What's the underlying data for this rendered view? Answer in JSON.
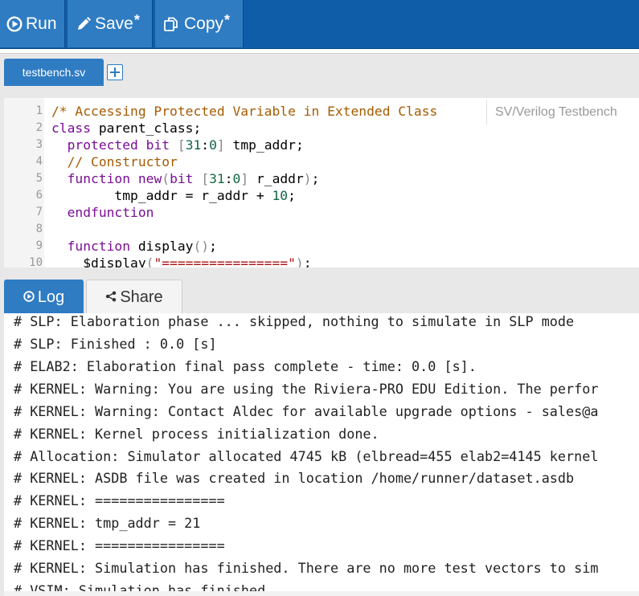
{
  "toolbar": {
    "run_label": "Run",
    "save_label": "Save",
    "copy_label": "Copy",
    "modified_marker": "*"
  },
  "editor": {
    "file_tab": "testbench.sv",
    "language_label": "SV/Verilog Testbench",
    "lines": [
      {
        "n": "1",
        "tokens": [
          {
            "t": "/* Accessing Protected Variable in Extended Class",
            "c": "cm"
          }
        ]
      },
      {
        "n": "2",
        "tokens": [
          {
            "t": "class",
            "c": "kw"
          },
          {
            "t": " parent_class;",
            "c": "pl"
          }
        ]
      },
      {
        "n": "3",
        "tokens": [
          {
            "t": "  protected",
            "c": "kw"
          },
          {
            "t": " ",
            "c": "pl"
          },
          {
            "t": "bit",
            "c": "kw"
          },
          {
            "t": " ",
            "c": "pl"
          },
          {
            "t": "[",
            "c": "bk"
          },
          {
            "t": "31",
            "c": "nm"
          },
          {
            "t": ":",
            "c": "pl"
          },
          {
            "t": "0",
            "c": "nm"
          },
          {
            "t": "]",
            "c": "bk"
          },
          {
            "t": " tmp_addr;",
            "c": "pl"
          }
        ]
      },
      {
        "n": "4",
        "tokens": [
          {
            "t": "  // Constructor",
            "c": "cm"
          }
        ]
      },
      {
        "n": "5",
        "tokens": [
          {
            "t": "  function",
            "c": "kw"
          },
          {
            "t": " ",
            "c": "pl"
          },
          {
            "t": "new",
            "c": "kw"
          },
          {
            "t": "(",
            "c": "bk"
          },
          {
            "t": "bit",
            "c": "kw"
          },
          {
            "t": " ",
            "c": "pl"
          },
          {
            "t": "[",
            "c": "bk"
          },
          {
            "t": "31",
            "c": "nm"
          },
          {
            "t": ":",
            "c": "pl"
          },
          {
            "t": "0",
            "c": "nm"
          },
          {
            "t": "]",
            "c": "bk"
          },
          {
            "t": " r_addr",
            "c": "pl"
          },
          {
            "t": ")",
            "c": "bk"
          },
          {
            "t": ";",
            "c": "pl"
          }
        ]
      },
      {
        "n": "6",
        "tokens": [
          {
            "t": "        tmp_addr = r_addr + ",
            "c": "pl"
          },
          {
            "t": "10",
            "c": "nm"
          },
          {
            "t": ";",
            "c": "pl"
          }
        ]
      },
      {
        "n": "7",
        "tokens": [
          {
            "t": "  endfunction",
            "c": "kw"
          }
        ]
      },
      {
        "n": "8",
        "tokens": []
      },
      {
        "n": "9",
        "tokens": [
          {
            "t": "  function",
            "c": "kw"
          },
          {
            "t": " display",
            "c": "pl"
          },
          {
            "t": "()",
            "c": "bk"
          },
          {
            "t": ";",
            "c": "pl"
          }
        ]
      },
      {
        "n": "10",
        "tokens": [
          {
            "t": "    $display",
            "c": "pl"
          },
          {
            "t": "(",
            "c": "bk"
          },
          {
            "t": "\"================\"",
            "c": "st"
          },
          {
            "t": ")",
            "c": "bk"
          },
          {
            "t": ";",
            "c": "pl"
          }
        ]
      }
    ]
  },
  "log": {
    "log_tab": "Log",
    "share_tab": "Share",
    "partial_top_line": "# SLP: Elaboration phase ... skipped, nothing to simulate in SLP mode",
    "lines": [
      "# SLP: Finished : 0.0 [s]",
      "# ELAB2: Elaboration final pass complete - time: 0.0 [s].",
      "# KERNEL: Warning: You are using the Riviera-PRO EDU Edition. The perfor",
      "# KERNEL: Warning: Contact Aldec for available upgrade options - sales@a",
      "# KERNEL: Kernel process initialization done.",
      "# Allocation: Simulator allocated 4745 kB (elbread=455 elab2=4145 kernel",
      "# KERNEL: ASDB file was created in location /home/runner/dataset.asdb",
      "# KERNEL: ================",
      "# KERNEL: tmp_addr = 21",
      "# KERNEL: ================",
      "# KERNEL: Simulation has finished. There are no more test vectors to sim",
      "# VSIM: Simulation has finished."
    ]
  }
}
